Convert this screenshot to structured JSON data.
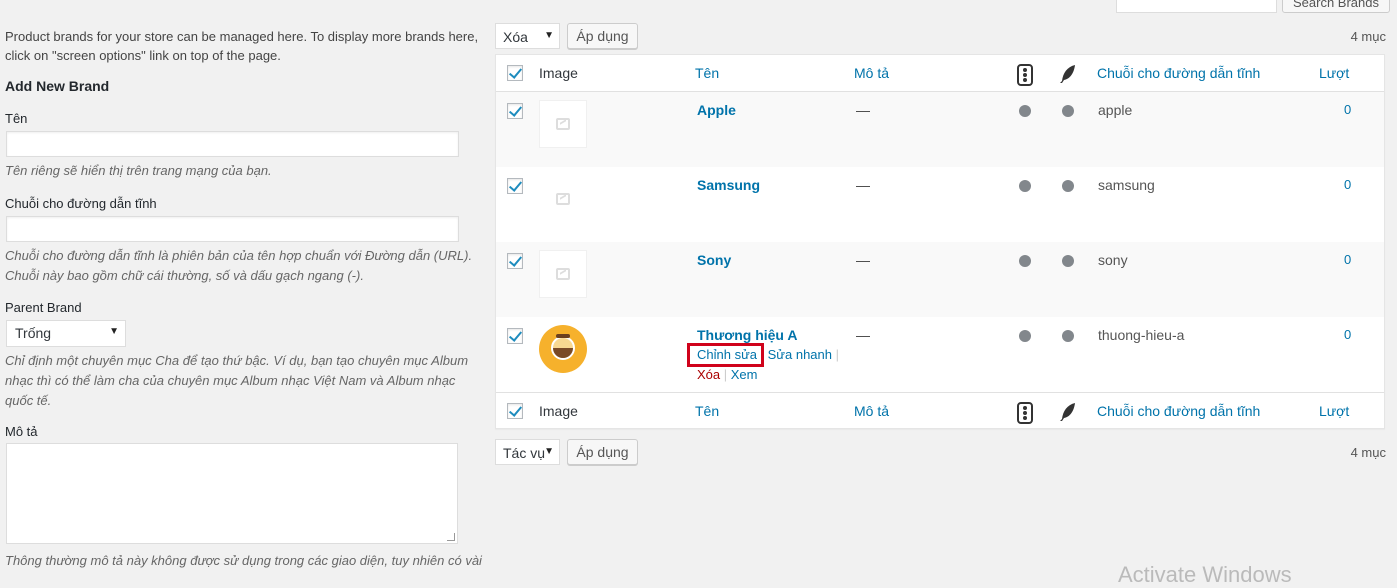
{
  "left": {
    "intro": "Product brands for your store can be managed here. To display more brands here, click on \"screen options\" link on top of the page.",
    "add_title": "Add New Brand",
    "name_label": "Tên",
    "name_hint": "Tên riêng sẽ hiển thị trên trang mạng của bạn.",
    "slug_label": "Chuỗi cho đường dẫn tĩnh",
    "slug_hint": "Chuỗi cho đường dẫn tĩnh là phiên bản của tên hợp chuẩn với Đường dẫn (URL). Chuỗi này bao gồm chữ cái thường, số và dấu gạch ngang (-).",
    "parent_label": "Parent Brand",
    "parent_value": "Trống",
    "parent_hint": "Chỉ định một chuyên mục Cha để tạo thứ bậc. Ví dụ, bạn tạo chuyên mục Album nhạc thì có thể làm cha của chuyên mục Album nhạc Việt Nam và Album nhạc quốc tế.",
    "desc_label": "Mô tả",
    "desc_hint": "Thông thường mô tả này không được sử dụng trong các giao diện, tuy nhiên có vài"
  },
  "search": {
    "button": "Search Brands"
  },
  "top_bar": {
    "bulk_value": "Xóa",
    "apply": "Áp dụng",
    "count": "4 mục"
  },
  "bottom_bar": {
    "bulk_value": "Tác vụ",
    "apply": "Áp dụng",
    "count": "4 mục"
  },
  "table": {
    "columns": {
      "image": "Image",
      "name": "Tên",
      "description": "Mô tả",
      "slug": "Chuỗi cho đường dẫn tĩnh",
      "count": "Lượt"
    },
    "rows": [
      {
        "name": "Apple",
        "description": "—",
        "slug": "apple",
        "count": "0"
      },
      {
        "name": "Samsung",
        "description": "—",
        "slug": "samsung",
        "count": "0"
      },
      {
        "name": "Sony",
        "description": "—",
        "slug": "sony",
        "count": "0"
      },
      {
        "name": "Thương hiệu A",
        "description": "—",
        "slug": "thuong-hieu-a",
        "count": "0"
      }
    ],
    "row_actions": {
      "edit": "Chỉnh sửa",
      "quick_edit": "Sửa nhanh",
      "delete": "Xóa",
      "view": "Xem"
    }
  },
  "watermark": "Activate Windows",
  "colors": {
    "link": "#0073aa",
    "highlight": "#d0021b",
    "delete": "#a00"
  }
}
